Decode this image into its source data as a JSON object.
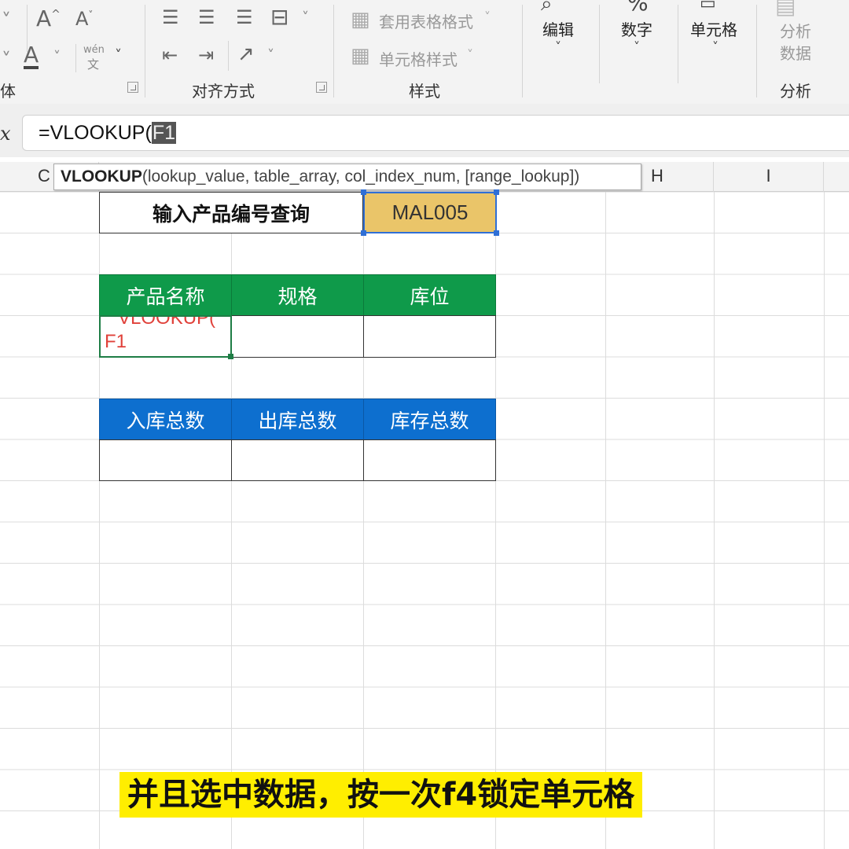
{
  "ribbon": {
    "font_group_label": "字体",
    "font_group_label_visible": "体",
    "grow_font_icon": "A^",
    "shrink_font_icon": "A˅",
    "font_color_icon": "A",
    "pinyin_top": "wén",
    "pinyin_bottom": "文",
    "align_group_label": "对齐方式",
    "styles": {
      "table_format": "套用表格格式",
      "cell_styles": "单元格样式",
      "group_label": "样式"
    },
    "edit_label": "编辑",
    "number_label": "数字",
    "number_icon": "%",
    "cells_label": "单元格",
    "analyze": {
      "line1": "分析",
      "line2": "数据",
      "group_label": "分析"
    }
  },
  "formula_bar": {
    "fx": "fx",
    "fx_visible": "x",
    "formula_prefix": "=VLOOKUP(",
    "formula_highlight": "F1"
  },
  "tooltip": {
    "function": "VLOOKUP",
    "args": "(lookup_value, table_array, col_index_num, [range_lookup])"
  },
  "columns": [
    "C",
    "H",
    "I"
  ],
  "sheet": {
    "query_label": "输入产品编号查询",
    "query_value": "MAL005",
    "table1_headers": [
      "产品名称",
      "规格",
      "库位"
    ],
    "edit_cell_line1": "VLOOKUP(",
    "edit_cell_line2": "F1",
    "table2_headers": [
      "入库总数",
      "出库总数",
      "库存总数"
    ]
  },
  "colors": {
    "green_header": "#0f9a4a",
    "blue_header": "#0d6fcf",
    "query_fill": "#eac569",
    "subtitle_bg": "#ffee00",
    "formula_red": "#e0413a"
  },
  "subtitle": "并且选中数据，按一次f4锁定单元格"
}
